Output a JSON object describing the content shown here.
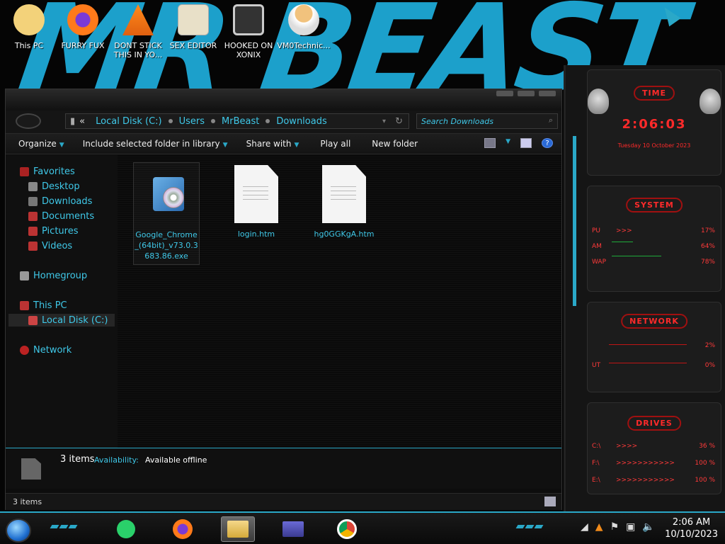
{
  "desktop": {
    "icons": [
      {
        "label": "This PC"
      },
      {
        "label": "FURRY FUX"
      },
      {
        "label": "DONT STICK THIS IN YO..."
      },
      {
        "label": "SEX EDITOR"
      },
      {
        "label": "HOOKED ON XONIX"
      },
      {
        "label": "VM0Technic..."
      }
    ]
  },
  "explorer": {
    "breadcrumb": [
      "Local Disk (C:)",
      "Users",
      "MrBeast",
      "Downloads"
    ],
    "breadcrumb_prefix": "«",
    "search_placeholder": "Search Downloads",
    "toolbar": {
      "organize": "Organize",
      "include_library": "Include selected folder in library",
      "share_with": "Share with",
      "play_all": "Play all",
      "new_folder": "New folder"
    },
    "nav": {
      "favorites": "Favorites",
      "desktop": "Desktop",
      "downloads": "Downloads",
      "documents": "Documents",
      "pictures": "Pictures",
      "videos": "Videos",
      "homegroup": "Homegroup",
      "this_pc": "This PC",
      "local_disk": "Local Disk (C:)",
      "network": "Network"
    },
    "files": [
      {
        "name": "Google_Chrome_(64bit)_v73.0.3683.86.exe",
        "kind": "installer"
      },
      {
        "name": "login.htm",
        "kind": "document"
      },
      {
        "name": "hg0GGKgA.htm",
        "kind": "document"
      }
    ],
    "details": {
      "count": "3 items",
      "availability_label": "Availability:",
      "availability_value": "Available offline"
    },
    "status": "3 items"
  },
  "gadgets": {
    "time": {
      "title": "TIME",
      "clock": "2:06:03",
      "date": "Tuesday 10 October 2023"
    },
    "system": {
      "title": "SYSTEM",
      "rows": [
        {
          "label": "PU",
          "value": "17%"
        },
        {
          "label": "AM",
          "value": "64%"
        },
        {
          "label": "WAP",
          "value": "78%"
        }
      ]
    },
    "network": {
      "title": "NETWORK",
      "rows": [
        {
          "label": "",
          "value": "2%"
        },
        {
          "label": "UT",
          "value": "0%"
        }
      ]
    },
    "drives": {
      "title": "DRIVES",
      "rows": [
        {
          "label": "C:\\",
          "value": "36 %"
        },
        {
          "label": "F:\\",
          "value": "100 %"
        },
        {
          "label": "E:\\",
          "value": "100 %"
        }
      ]
    }
  },
  "taskbar": {
    "clock_time": "2:06 AM",
    "clock_date": "10/10/2023"
  },
  "colors": {
    "accent": "#2aa8c8",
    "link": "#3fc8e8",
    "gadget_red": "#ff2a2a"
  }
}
